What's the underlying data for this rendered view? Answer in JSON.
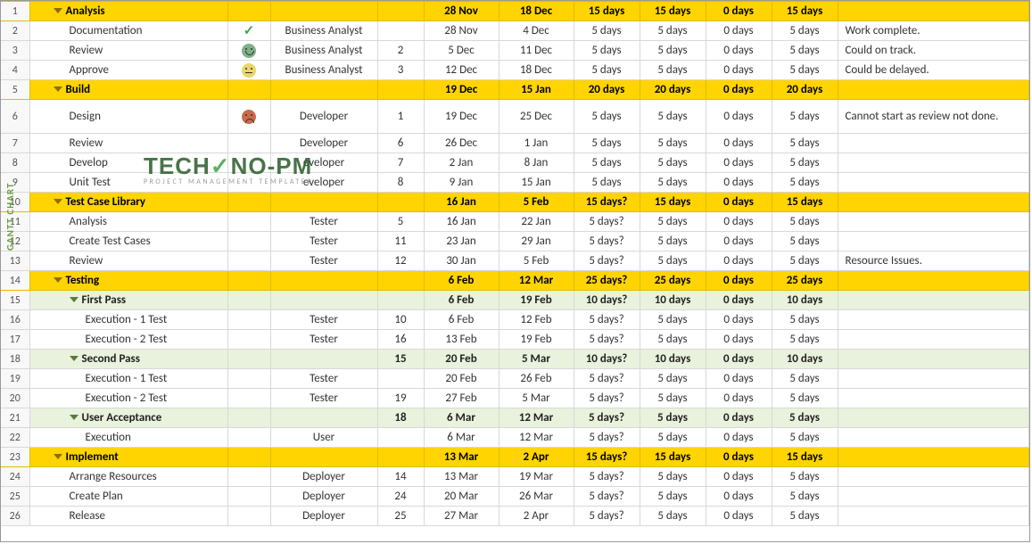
{
  "sideTab": "GANTT CHART",
  "watermark": {
    "brand1": "TECH",
    "brand2": "NO-PM",
    "sub": "PROJECT MANAGEMENT TEMPLATES"
  },
  "rows": [
    {
      "n": 1,
      "cls": "yellow",
      "ind": 0,
      "tog": true,
      "task": "Analysis",
      "stat": "",
      "res": "",
      "pred": "",
      "start": "28 Nov",
      "fin": "18 Dec",
      "d1": "15 days",
      "d2": "15 days",
      "d3": "0 days",
      "d4": "15 days",
      "note": ""
    },
    {
      "n": 2,
      "cls": "",
      "ind": 1,
      "tog": false,
      "task": "Documentation",
      "stat": "check",
      "res": "Business Analyst",
      "pred": "",
      "start": "28 Nov",
      "fin": "4 Dec",
      "d1": "5 days",
      "d2": "5 days",
      "d3": "0 days",
      "d4": "5 days",
      "note": "Work complete."
    },
    {
      "n": 3,
      "cls": "",
      "ind": 1,
      "tog": false,
      "task": "Review",
      "stat": "smile",
      "res": "Business Analyst",
      "pred": "2",
      "start": "5 Dec",
      "fin": "11 Dec",
      "d1": "5 days",
      "d2": "5 days",
      "d3": "0 days",
      "d4": "5 days",
      "note": "Could on track."
    },
    {
      "n": 4,
      "cls": "",
      "ind": 1,
      "tog": false,
      "task": "Approve",
      "stat": "neutral",
      "res": "Business Analyst",
      "pred": "3",
      "start": "12 Dec",
      "fin": "18 Dec",
      "d1": "5 days",
      "d2": "5 days",
      "d3": "0 days",
      "d4": "5 days",
      "note": "Could be delayed."
    },
    {
      "n": 5,
      "cls": "yellow",
      "ind": 0,
      "tog": true,
      "task": "Build",
      "stat": "",
      "res": "",
      "pred": "",
      "start": "19 Dec",
      "fin": "15 Jan",
      "d1": "20 days",
      "d2": "20 days",
      "d3": "0 days",
      "d4": "20 days",
      "note": ""
    },
    {
      "n": 6,
      "cls": "",
      "ind": 1,
      "tog": false,
      "task": "Design",
      "stat": "sad",
      "res": "Developer",
      "pred": "1",
      "start": "19 Dec",
      "fin": "25 Dec",
      "d1": "5 days",
      "d2": "5 days",
      "d3": "0 days",
      "d4": "5 days",
      "note": "Cannot start as review not done."
    },
    {
      "n": 7,
      "cls": "",
      "ind": 1,
      "tog": false,
      "task": "Review",
      "stat": "",
      "res": "Developer",
      "pred": "6",
      "start": "26 Dec",
      "fin": "1 Jan",
      "d1": "5 days",
      "d2": "5 days",
      "d3": "0 days",
      "d4": "5 days",
      "note": ""
    },
    {
      "n": 8,
      "cls": "",
      "ind": 1,
      "tog": false,
      "task": "Develop",
      "stat": "",
      "res": "eveloper",
      "pred": "7",
      "start": "2 Jan",
      "fin": "8 Jan",
      "d1": "5 days",
      "d2": "5 days",
      "d3": "0 days",
      "d4": "5 days",
      "note": ""
    },
    {
      "n": 9,
      "cls": "",
      "ind": 1,
      "tog": false,
      "task": "Unit Test",
      "stat": "",
      "res": "eveloper",
      "pred": "8",
      "start": "9 Jan",
      "fin": "15 Jan",
      "d1": "5 days",
      "d2": "5 days",
      "d3": "0 days",
      "d4": "5 days",
      "note": ""
    },
    {
      "n": 10,
      "cls": "yellow",
      "ind": 0,
      "tog": true,
      "task": "Test Case Library",
      "stat": "",
      "res": "",
      "pred": "",
      "start": "16 Jan",
      "fin": "5 Feb",
      "d1": "15 days?",
      "d2": "15 days",
      "d3": "0 days",
      "d4": "15 days",
      "note": ""
    },
    {
      "n": 11,
      "cls": "",
      "ind": 1,
      "tog": false,
      "task": "Analysis",
      "stat": "",
      "res": "Tester",
      "pred": "5",
      "start": "16 Jan",
      "fin": "22 Jan",
      "d1": "5 days?",
      "d2": "5 days",
      "d3": "0 days",
      "d4": "5 days",
      "note": ""
    },
    {
      "n": 12,
      "cls": "",
      "ind": 1,
      "tog": false,
      "task": "Create Test Cases",
      "stat": "",
      "res": "Tester",
      "pred": "11",
      "start": "23 Jan",
      "fin": "29 Jan",
      "d1": "5 days?",
      "d2": "5 days",
      "d3": "0 days",
      "d4": "5 days",
      "note": ""
    },
    {
      "n": 13,
      "cls": "",
      "ind": 1,
      "tog": false,
      "task": "Review",
      "stat": "",
      "res": "Tester",
      "pred": "12",
      "start": "30 Jan",
      "fin": "5 Feb",
      "d1": "5 days?",
      "d2": "5 days",
      "d3": "0 days",
      "d4": "5 days",
      "note": "Resource Issues."
    },
    {
      "n": 14,
      "cls": "yellow",
      "ind": 0,
      "tog": true,
      "task": "Testing",
      "stat": "",
      "res": "",
      "pred": "",
      "start": "6 Feb",
      "fin": "12 Mar",
      "d1": "25 days?",
      "d2": "25 days",
      "d3": "0 days",
      "d4": "25 days",
      "note": ""
    },
    {
      "n": 15,
      "cls": "green",
      "ind": 1,
      "tog": true,
      "task": "First Pass",
      "stat": "",
      "res": "",
      "pred": "",
      "start": "6 Feb",
      "fin": "19 Feb",
      "d1": "10 days?",
      "d2": "10 days",
      "d3": "0 days",
      "d4": "10 days",
      "note": ""
    },
    {
      "n": 16,
      "cls": "",
      "ind": 2,
      "tog": false,
      "task": "Execution - 1 Test",
      "stat": "",
      "res": "Tester",
      "pred": "10",
      "start": "6 Feb",
      "fin": "12 Feb",
      "d1": "5 days?",
      "d2": "5 days",
      "d3": "0 days",
      "d4": "5 days",
      "note": ""
    },
    {
      "n": 17,
      "cls": "",
      "ind": 2,
      "tog": false,
      "task": "Execution - 2 Test",
      "stat": "",
      "res": "Tester",
      "pred": "16",
      "start": "13 Feb",
      "fin": "19 Feb",
      "d1": "5 days?",
      "d2": "5 days",
      "d3": "0 days",
      "d4": "5 days",
      "note": ""
    },
    {
      "n": 18,
      "cls": "green",
      "ind": 1,
      "tog": true,
      "task": "Second Pass",
      "stat": "",
      "res": "",
      "pred": "15",
      "start": "20 Feb",
      "fin": "5 Mar",
      "d1": "10 days?",
      "d2": "10 days",
      "d3": "0 days",
      "d4": "10 days",
      "note": ""
    },
    {
      "n": 19,
      "cls": "",
      "ind": 2,
      "tog": false,
      "task": "Execution - 1 Test",
      "stat": "",
      "res": "Tester",
      "pred": "",
      "start": "20 Feb",
      "fin": "26 Feb",
      "d1": "5 days?",
      "d2": "5 days",
      "d3": "0 days",
      "d4": "5 days",
      "note": ""
    },
    {
      "n": 20,
      "cls": "",
      "ind": 2,
      "tog": false,
      "task": "Execution - 2 Test",
      "stat": "",
      "res": "Tester",
      "pred": "19",
      "start": "27 Feb",
      "fin": "5 Mar",
      "d1": "5 days?",
      "d2": "5 days",
      "d3": "0 days",
      "d4": "5 days",
      "note": ""
    },
    {
      "n": 21,
      "cls": "green",
      "ind": 1,
      "tog": true,
      "task": "User Acceptance",
      "stat": "",
      "res": "",
      "pred": "18",
      "start": "6 Mar",
      "fin": "12 Mar",
      "d1": "5 days?",
      "d2": "5 days",
      "d3": "0 days",
      "d4": "5 days",
      "note": ""
    },
    {
      "n": 22,
      "cls": "",
      "ind": 2,
      "tog": false,
      "task": "Execution",
      "stat": "",
      "res": "User",
      "pred": "",
      "start": "6 Mar",
      "fin": "12 Mar",
      "d1": "5 days?",
      "d2": "5 days",
      "d3": "0 days",
      "d4": "5 days",
      "note": ""
    },
    {
      "n": 23,
      "cls": "yellow",
      "ind": 0,
      "tog": true,
      "task": "Implement",
      "stat": "",
      "res": "",
      "pred": "",
      "start": "13 Mar",
      "fin": "2 Apr",
      "d1": "15 days?",
      "d2": "15 days",
      "d3": "0 days",
      "d4": "15 days",
      "note": ""
    },
    {
      "n": 24,
      "cls": "",
      "ind": 1,
      "tog": false,
      "task": "Arrange Resources",
      "stat": "",
      "res": "Deployer",
      "pred": "14",
      "start": "13 Mar",
      "fin": "19 Mar",
      "d1": "5 days?",
      "d2": "5 days",
      "d3": "0 days",
      "d4": "5 days",
      "note": ""
    },
    {
      "n": 25,
      "cls": "",
      "ind": 1,
      "tog": false,
      "task": "Create Plan",
      "stat": "",
      "res": "Deployer",
      "pred": "24",
      "start": "20 Mar",
      "fin": "26 Mar",
      "d1": "5 days?",
      "d2": "5 days",
      "d3": "0 days",
      "d4": "5 days",
      "note": ""
    },
    {
      "n": 26,
      "cls": "",
      "ind": 1,
      "tog": false,
      "task": "Release",
      "stat": "",
      "res": "Deployer",
      "pred": "25",
      "start": "27 Mar",
      "fin": "2 Apr",
      "d1": "5 days?",
      "d2": "5 days",
      "d3": "0 days",
      "d4": "5 days",
      "note": ""
    }
  ]
}
